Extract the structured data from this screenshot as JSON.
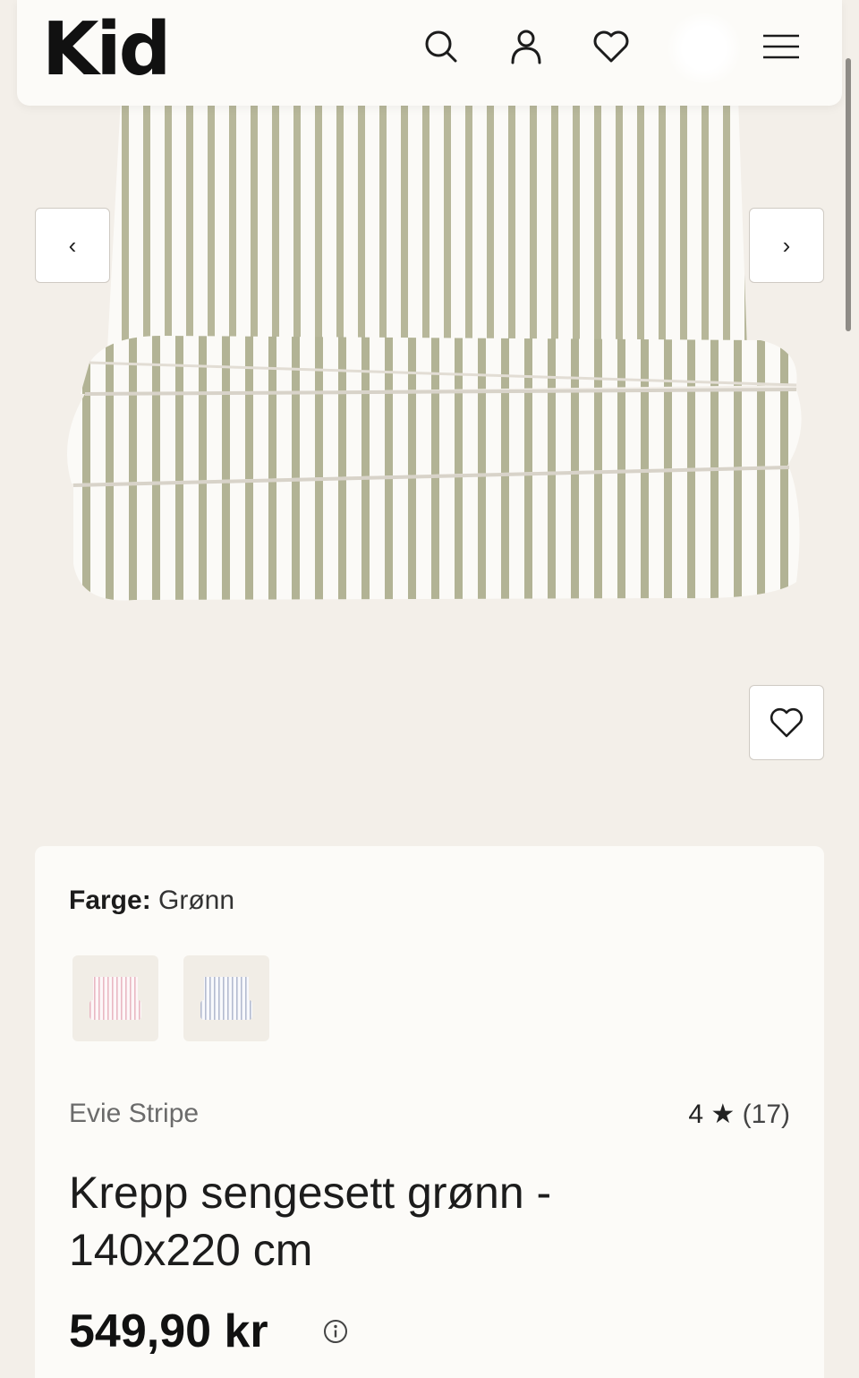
{
  "header": {
    "logo": "Kid",
    "icons": [
      "search-icon",
      "account-icon",
      "heart-icon",
      "menu-icon"
    ]
  },
  "gallery": {
    "prev_label": "‹",
    "next_label": "›",
    "stripe_color": "#b7b79a"
  },
  "product": {
    "color_label": "Farge:",
    "color_value": "Grønn",
    "swatches": [
      "pink-striped-bedding",
      "blue-striped-bedding"
    ],
    "brand": "Evie Stripe",
    "rating": "4",
    "rating_star": "★",
    "review_count": "(17)",
    "title": "Krepp sengesett grønn - 140x220 cm",
    "price": "549,90 kr"
  }
}
